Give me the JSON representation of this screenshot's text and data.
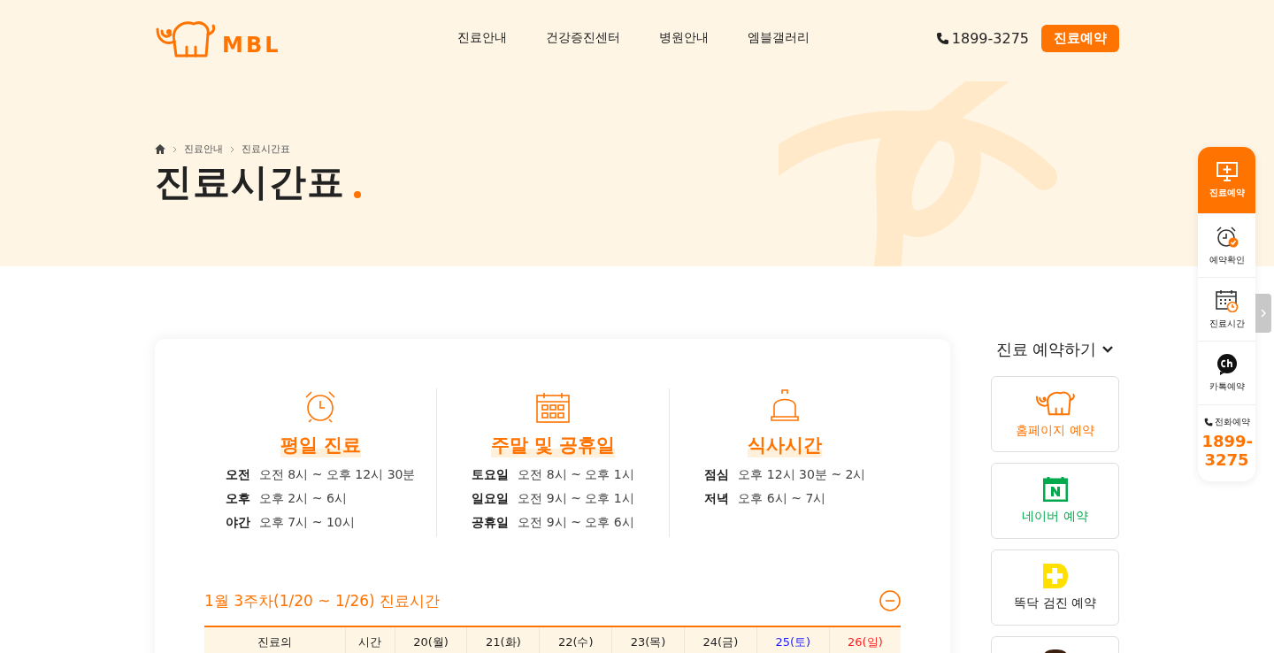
{
  "header": {
    "logo": "MBL",
    "nav": [
      "진료안내",
      "건강증진센터",
      "병원안내",
      "엠블갤러리"
    ],
    "phone": "1899-3275",
    "cta": "진료예약"
  },
  "breadcrumb": [
    "진료안내",
    "진료시간표"
  ],
  "page_title": "진료시간표",
  "hours": [
    {
      "kind": "clock",
      "title": "평일 진료",
      "rows": [
        {
          "label": "오전",
          "value": "오전 8시 ~ 오후 12시 30분"
        },
        {
          "label": "오후",
          "value": "오후 2시 ~ 6시"
        },
        {
          "label": "야간",
          "value": "오후 7시 ~ 10시"
        }
      ]
    },
    {
      "kind": "calendar",
      "title": "주말 및 공휴일",
      "rows": [
        {
          "label": "토요일",
          "value": "오전 8시 ~ 오후 1시"
        },
        {
          "label": "일요일",
          "value": "오전 9시 ~ 오후 1시"
        },
        {
          "label": "공휴일",
          "value": "오전 9시 ~ 오후 6시"
        }
      ]
    },
    {
      "kind": "bell",
      "title": "식사시간",
      "rows": [
        {
          "label": "점심",
          "value": "오후 12시 30분 ~ 2시"
        },
        {
          "label": "저녁",
          "value": "오후 6시 ~ 7시"
        }
      ]
    }
  ],
  "week": {
    "title": "1월 3주차(1/20 ~ 1/26) 진료시간",
    "expanded": true,
    "columns": [
      {
        "label": "진료의",
        "kind": "plain"
      },
      {
        "label": "시간",
        "kind": "plain"
      },
      {
        "label": "20(월)",
        "kind": "weekday"
      },
      {
        "label": "21(화)",
        "kind": "weekday"
      },
      {
        "label": "22(수)",
        "kind": "weekday"
      },
      {
        "label": "23(목)",
        "kind": "weekday"
      },
      {
        "label": "24(금)",
        "kind": "weekday"
      },
      {
        "label": "25(토)",
        "kind": "saturday"
      },
      {
        "label": "26(일)",
        "kind": "sunday"
      }
    ]
  },
  "booking": {
    "title": "진료 예약하기",
    "items": [
      {
        "kind": "homepage",
        "label": "홈페이지 예약"
      },
      {
        "kind": "naver",
        "label": "네이버 예약"
      },
      {
        "kind": "ddocdoc",
        "label": "똑닥 검진 예약"
      },
      {
        "kind": "partial"
      }
    ]
  },
  "quick_menu": {
    "items": [
      {
        "kind": "monitor",
        "label": "진료예약",
        "selected": true
      },
      {
        "kind": "alarm",
        "label": "예약확인",
        "selected": false
      },
      {
        "kind": "calendar",
        "label": "진료시간",
        "selected": false
      },
      {
        "kind": "chat",
        "label": "카톡예약",
        "selected": false
      }
    ],
    "phone_label": "전화예약",
    "phone": "1899-3275"
  }
}
